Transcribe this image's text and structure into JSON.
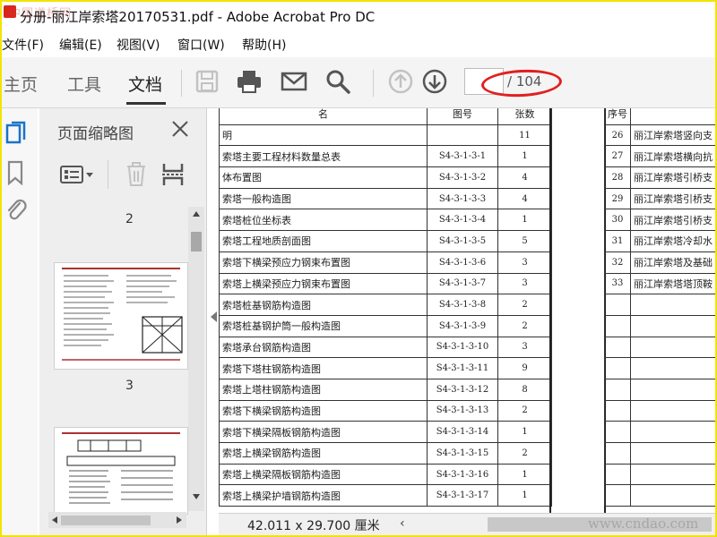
{
  "window": {
    "title": "分册-丽江岸索塔20170531.pdf - Adobe Acrobat Pro DC",
    "watermark_top": "中国道桥网"
  },
  "menu": [
    "文件(F)",
    "编辑(E)",
    "视图(V)",
    "窗口(W)",
    "帮助(H)"
  ],
  "tabs": [
    "主页",
    "工具",
    "文档"
  ],
  "toolbar": {
    "page_current": "",
    "page_total": "/ 104",
    "annotation_color": "#e02020"
  },
  "panel": {
    "title": "页面缩略图",
    "pages": [
      "2",
      "3"
    ]
  },
  "table_left": {
    "header": [
      "名",
      "图号",
      "张数"
    ],
    "rows": [
      {
        "name": "明",
        "code": "",
        "count": "11"
      },
      {
        "name": "索塔主要工程材料数量总表",
        "code": "S4-3-1-3-1",
        "count": "1"
      },
      {
        "name": "体布置图",
        "code": "S4-3-1-3-2",
        "count": "4"
      },
      {
        "name": "索塔一般构造图",
        "code": "S4-3-1-3-3",
        "count": "4"
      },
      {
        "name": "索塔桩位坐标表",
        "code": "S4-3-1-3-4",
        "count": "1"
      },
      {
        "name": "索塔工程地质剖面图",
        "code": "S4-3-1-3-5",
        "count": "5"
      },
      {
        "name": "索塔下横梁预应力钢束布置图",
        "code": "S4-3-1-3-6",
        "count": "3"
      },
      {
        "name": "索塔上横梁预应力钢束布置图",
        "code": "S4-3-1-3-7",
        "count": "3"
      },
      {
        "name": "索塔桩基钢筋构造图",
        "code": "S4-3-1-3-8",
        "count": "2"
      },
      {
        "name": "索塔桩基钢护筒一般构造图",
        "code": "S4-3-1-3-9",
        "count": "2"
      },
      {
        "name": "索塔承台钢筋构造图",
        "code": "S4-3-1-3-10",
        "count": "3"
      },
      {
        "name": "索塔下塔柱钢筋构造图",
        "code": "S4-3-1-3-11",
        "count": "9"
      },
      {
        "name": "索塔上塔柱钢筋构造图",
        "code": "S4-3-1-3-12",
        "count": "8"
      },
      {
        "name": "索塔下横梁钢筋构造图",
        "code": "S4-3-1-3-13",
        "count": "2"
      },
      {
        "name": "索塔下横梁隔板钢筋构造图",
        "code": "S4-3-1-3-14",
        "count": "1"
      },
      {
        "name": "索塔上横梁钢筋构造图",
        "code": "S4-3-1-3-15",
        "count": "2"
      },
      {
        "name": "索塔上横梁隔板钢筋构造图",
        "code": "S4-3-1-3-16",
        "count": "1"
      },
      {
        "name": "索塔上横梁护墙钢筋构造图",
        "code": "S4-3-1-3-17",
        "count": "1"
      }
    ]
  },
  "table_right": {
    "header_num": "序号",
    "rows": [
      {
        "num": "26",
        "name": "丽江岸索塔竖向支"
      },
      {
        "num": "27",
        "name": "丽江岸索塔横向抗"
      },
      {
        "num": "28",
        "name": "丽江岸索塔引桥支"
      },
      {
        "num": "29",
        "name": "丽江岸索塔引桥支"
      },
      {
        "num": "30",
        "name": "丽江岸索塔引桥支"
      },
      {
        "num": "31",
        "name": "丽江岸索塔冷却水"
      },
      {
        "num": "32",
        "name": "丽江岸索塔及基础"
      },
      {
        "num": "33",
        "name": "丽江岸索塔塔顶鞍"
      }
    ],
    "blank_rows": 10
  },
  "status": {
    "dimensions": "42.011 x 29.700 厘米",
    "watermark_bottom": "www.cndao.com"
  }
}
